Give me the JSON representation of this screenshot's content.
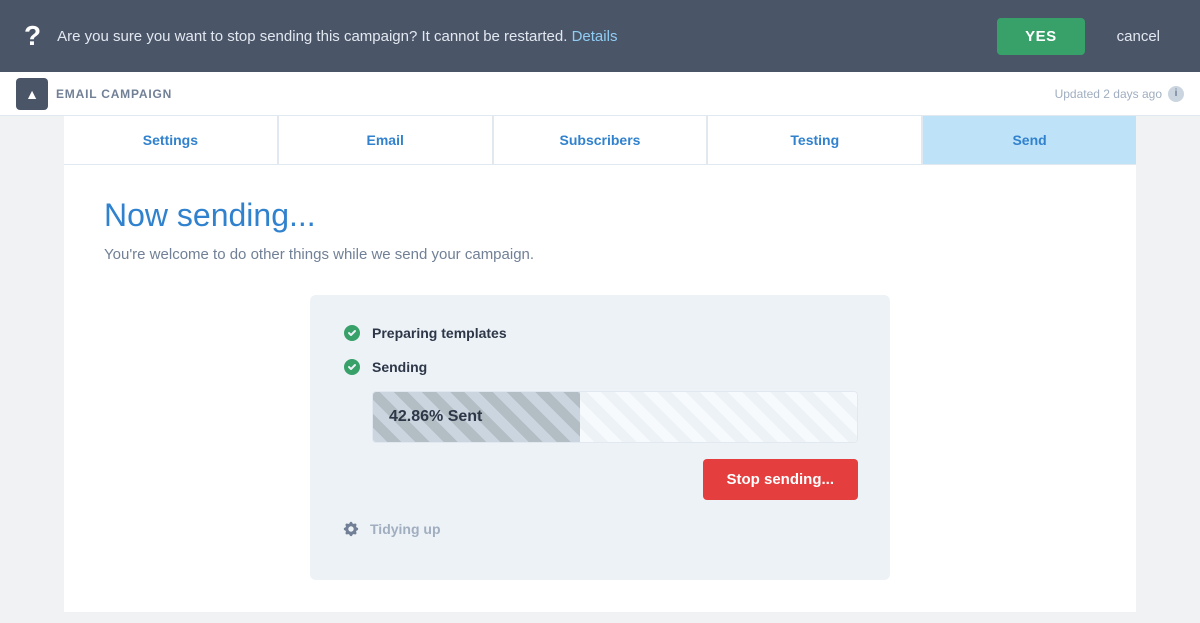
{
  "banner": {
    "question_mark": "?",
    "message": "Are you sure you want to stop sending this campaign? It cannot be restarted.",
    "details_link": "Details",
    "yes_label": "YES",
    "cancel_label": "cancel"
  },
  "header": {
    "collapse_icon": "▲",
    "campaign_type": "EMAIL CAMPAIGN",
    "updated_text": "Updated 2 days ago",
    "info_icon": "i"
  },
  "steps": [
    {
      "label": "Settings",
      "active": false
    },
    {
      "label": "Email",
      "active": false
    },
    {
      "label": "Subscribers",
      "active": false
    },
    {
      "label": "Testing",
      "active": false
    },
    {
      "label": "Send",
      "active": true
    }
  ],
  "main": {
    "title": "Now sending...",
    "subtitle": "You're welcome to do other things while we send your campaign.",
    "status_items": [
      {
        "label": "Preparing templates",
        "done": true
      },
      {
        "label": "Sending",
        "done": true
      },
      {
        "label": "Tidying up",
        "done": false
      }
    ],
    "progress": {
      "percent": 42.86,
      "label": "42.86% Sent"
    },
    "stop_button_label": "Stop sending..."
  }
}
